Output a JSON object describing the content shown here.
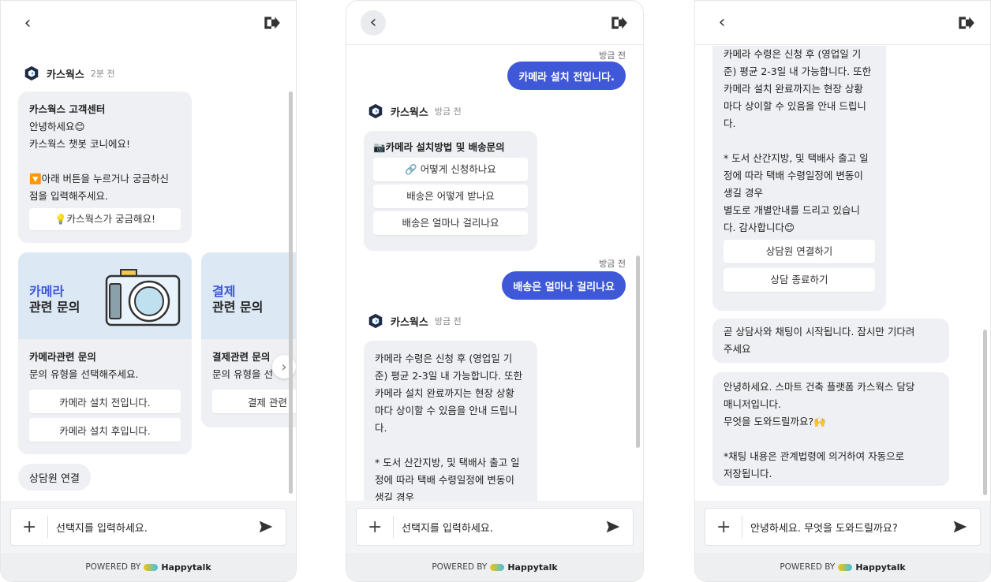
{
  "common": {
    "placeholder": "선택지를 입력하세요.",
    "powered_by": "POWERED BY",
    "brand": "Happytalk",
    "bot_name": "카스웍스"
  },
  "panel1": {
    "bot_time": "2분 전",
    "welcome_title": "카스웍스 고객센터",
    "welcome_line1": "안녕하세요😊",
    "welcome_line2": "카스웍스 챗봇 코니에요!",
    "welcome_line3": "🔽아래 버튼을 누르거나 궁금하신",
    "welcome_line4": "점을 입력해주세요.",
    "curious_button": "💡카스웍스가 궁금해요!",
    "cards": [
      {
        "title1": "카메라",
        "title2": "관련 문의",
        "heading": "카메라관련 문의",
        "desc": "문의 유형을 선택해주세요.",
        "opt1": "카메라 설치 전입니다.",
        "opt2": "카메라 설치 후입니다."
      },
      {
        "title1": "결제",
        "title2": "관련 문의",
        "heading": "결제관련 문의",
        "desc": "문의 유형을 선",
        "opt1": "결제 관련"
      }
    ],
    "agent_button": "상담원 연결"
  },
  "panel2": {
    "msg1_time": "방금 전",
    "msg1": "카메라 설치 전입니다.",
    "bot_time": "방금 전",
    "menu_title": "📷카메라 설치방법 및 배송문의",
    "menu_opt1": "🔗 어떻게 신청하나요",
    "menu_opt2": "배송은 어떻게 받나요",
    "menu_opt3": "배송은 얼마나 걸리나요",
    "msg2_time": "방금 전",
    "msg2": "배송은 얼마나 걸리나요",
    "bot2_time": "방금 전",
    "reply_lines": [
      "카메라 수령은 신청 후 (영업일 기",
      "준) 평균 2-3일 내 가능합니다. 또한",
      "카메라 설치 완료까지는 현장 상황",
      "마다 상이할 수 있음을 안내 드립니",
      "다.",
      "",
      "* 도서 산간지방, 및 택배사 출고 일",
      "정에 따라 택배 수령일정에 변동이",
      "생길 경우"
    ]
  },
  "panel3": {
    "reply_lines": [
      "카메라 수령은 신청 후 (영업일 기",
      "준) 평균 2-3일 내 가능합니다. 또한",
      "카메라 설치 완료까지는 현장 상황",
      "마다 상이할 수 있음을 안내 드립니",
      "다.",
      "",
      "* 도서 산간지방, 및 택배사 출고 일",
      "정에 따라 택배 수령일정에 변동이",
      "생길 경우",
      "별도로 개별안내를 드리고 있습니",
      "다. 감사합니다😊"
    ],
    "btn_connect": "상담원 연결하기",
    "btn_end": "상담 종료하기",
    "msg_wait_l1": "곧 상담사와 채팅이 시작됩니다. 잠시만 기다려",
    "msg_wait_l2": "주세요",
    "msg_hello_lines": [
      "안녕하세요. 스마트 건축 플랫폼 카스웍스 담당",
      "매니저입니다.",
      "무엇을 도와드릴까요?🙌",
      "",
      "*채팅 내용은 관계법령에 의거하여 자동으로",
      "저장됩니다."
    ],
    "input_value": "안녕하세요. 무엇을 도와드릴까요?"
  },
  "colors": {
    "accent": "#3f58d8",
    "bubble": "#eef0f3",
    "card_top": "#dce9f5"
  }
}
